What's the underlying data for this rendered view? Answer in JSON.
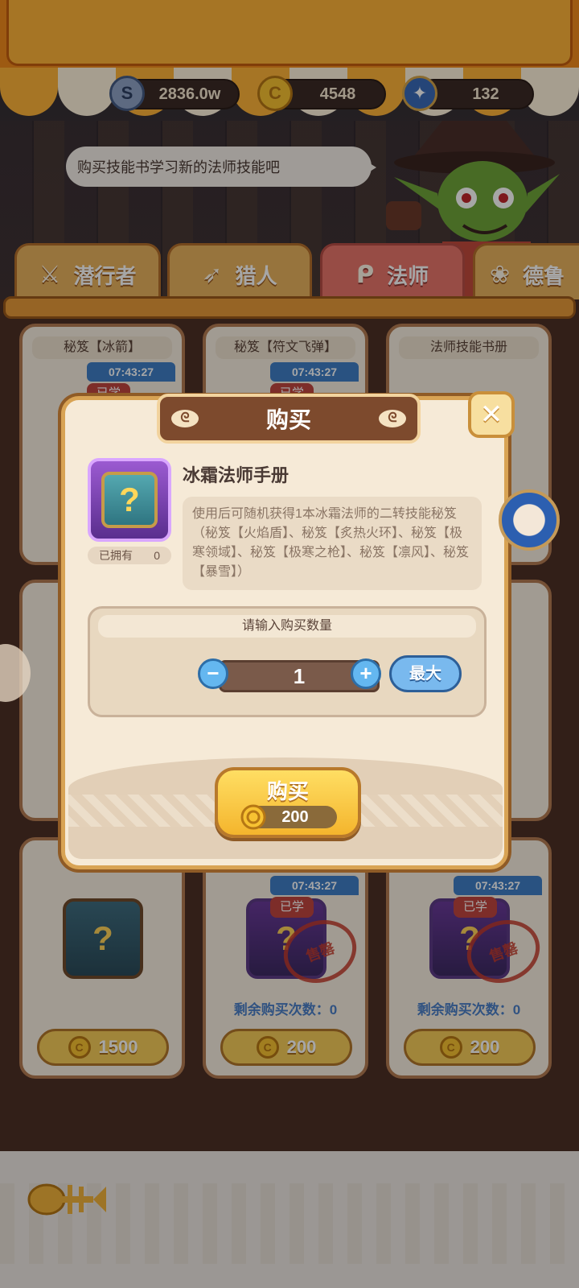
{
  "currencies": [
    {
      "icon": "silver-coin-icon",
      "value": "2836.0w"
    },
    {
      "icon": "gold-coin-icon",
      "value": "4548"
    },
    {
      "icon": "star-gem-icon",
      "value": "132"
    }
  ],
  "npc": {
    "speech": "购买技能书学习新的法师技能吧"
  },
  "tabs": [
    {
      "label": "潜行者",
      "icon": "dagger-icon",
      "active": false
    },
    {
      "label": "猎人",
      "icon": "bow-icon",
      "active": false
    },
    {
      "label": "法师",
      "icon": "staff-icon",
      "active": true
    },
    {
      "label": "德鲁",
      "icon": "paw-icon",
      "active": false
    }
  ],
  "shop": {
    "cards_top": [
      {
        "title": "秘笈【冰箭】",
        "timer": "07:43:27",
        "learned": "已学"
      },
      {
        "title": "秘笈【符文飞弹】",
        "timer": "07:43:27",
        "learned": "已学"
      },
      {
        "title": "法师技能书册"
      }
    ],
    "cards_bottom": [
      {
        "price": "1500"
      },
      {
        "timer": "07:43:27",
        "learned": "已学",
        "remain": "剩余购买次数：0",
        "price": "200",
        "stamp": "售罄"
      },
      {
        "timer": "07:43:27",
        "learned": "已学",
        "remain": "剩余购买次数：0",
        "price": "200",
        "stamp": "售罄"
      }
    ]
  },
  "modal": {
    "title": "购买",
    "item_name": "冰霜法师手册",
    "owned_label": "已拥有",
    "owned_count": "0",
    "description": "使用后可随机获得1本冰霜法师的二转技能秘笈（秘笈【火焰盾】、秘笈【炙热火环】、秘笈【极寒领域】、秘笈【极寒之枪】、秘笈【凛风】、秘笈【暴雪】）",
    "quantity_prompt": "请输入购买数量",
    "quantity": "1",
    "minus": "−",
    "plus": "+",
    "max_label": "最大",
    "buy_label": "购买",
    "buy_price": "200",
    "close": "✕"
  }
}
